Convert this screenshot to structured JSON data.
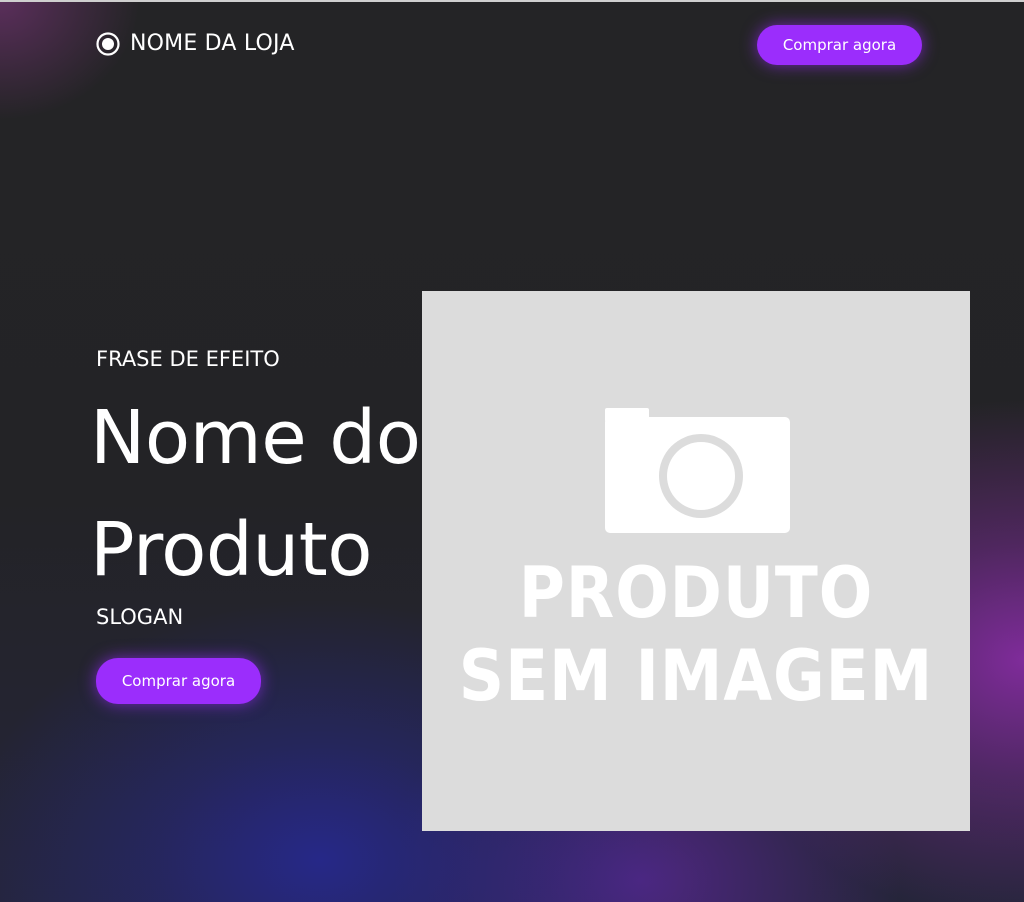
{
  "header": {
    "store_name": "NOME DA LOJA",
    "logo_icon": "radio-circle-icon",
    "buy_button_label": "Comprar agora"
  },
  "hero": {
    "tagline": "FRASE DE EFEITO",
    "product_name": "Nome do Produto",
    "slogan": "SLOGAN",
    "buy_button_label": "Comprar agora"
  },
  "product_image": {
    "icon": "camera-icon",
    "placeholder_line1": "PRODUTO",
    "placeholder_line2": "SEM IMAGEM"
  },
  "colors": {
    "accent": "#9b2dfc",
    "background": "#232325",
    "image_placeholder": "#dcdcdc",
    "text": "#ffffff"
  }
}
